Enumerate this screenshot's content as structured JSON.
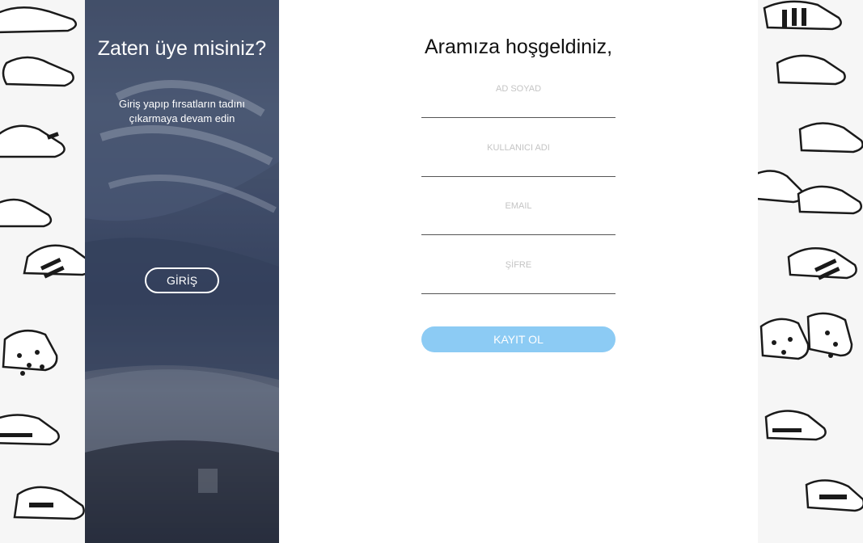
{
  "side_panel": {
    "title": "Zaten üye misiniz?",
    "subtitle": "Giriş yapıp fırsatların tadını çıkarmaya devam edin",
    "login_button": "GİRİŞ"
  },
  "form": {
    "heading": "Aramıza hoşgeldiniz,",
    "fields": [
      {
        "label": "AD SOYAD",
        "value": ""
      },
      {
        "label": "KULLANICI ADI",
        "value": ""
      },
      {
        "label": "EMAIL",
        "value": ""
      },
      {
        "label": "ŞİFRE",
        "value": ""
      }
    ],
    "submit_button": "KAYIT OL"
  },
  "colors": {
    "accent": "#8ccbf4",
    "side_panel": "#4a5877",
    "input_line": "#555555",
    "label": "#c4c4c4"
  },
  "icons": {
    "background_pattern": "shoe-doodle-pattern",
    "side_image": "sneaker-photo"
  }
}
